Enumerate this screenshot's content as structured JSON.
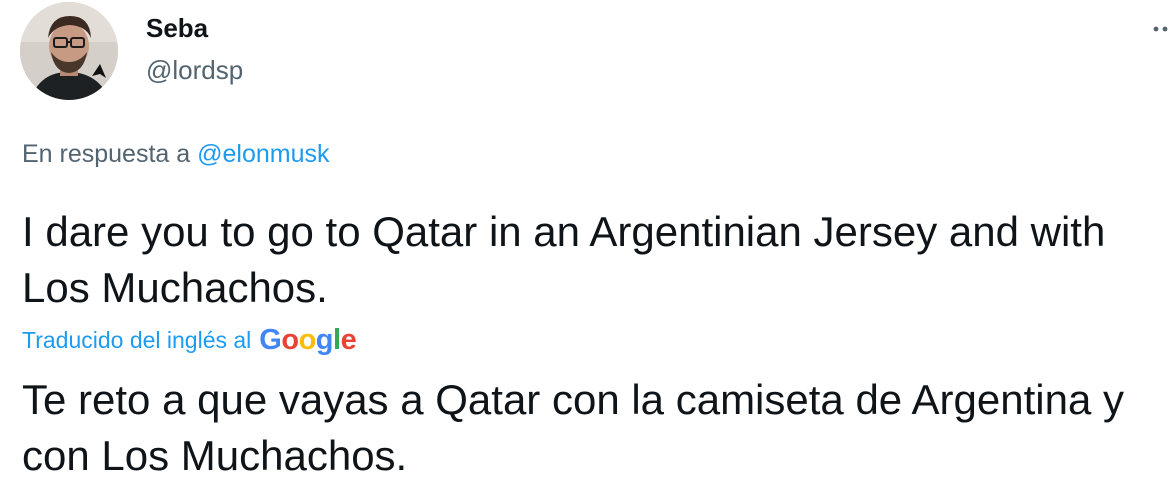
{
  "author": {
    "display_name": "Seba",
    "handle": "@lordsp"
  },
  "reply": {
    "prefix": "En respuesta a",
    "mention": "@elonmusk"
  },
  "tweet": {
    "text": "I dare you to go to Qatar in an Argentinian Jersey and with Los Muchachos."
  },
  "translation": {
    "label": "Traducido del inglés al",
    "provider_logo": "Google",
    "text": "Te reto a que vayas a Qatar con la camiseta de Argentina y con Los Muchachos."
  },
  "icons": {
    "more": "more-options-icon",
    "avatar": "avatar"
  },
  "colors": {
    "link": "#1d9bf0",
    "secondary_text": "#536471",
    "primary_text": "#0f1419"
  }
}
